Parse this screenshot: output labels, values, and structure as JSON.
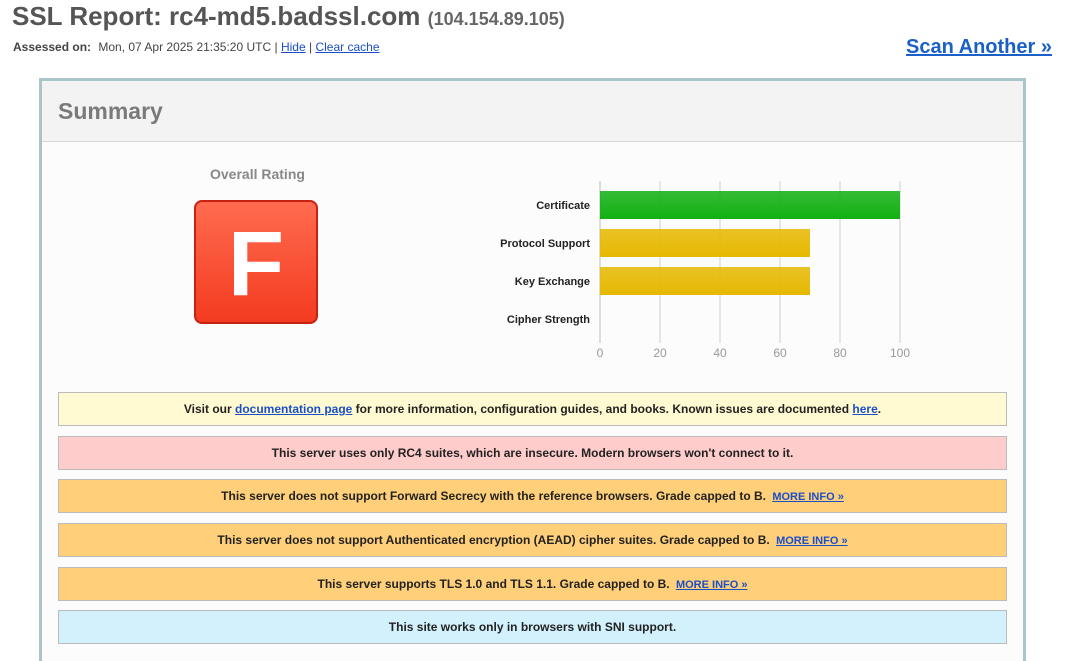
{
  "header": {
    "title_prefix": "SSL Report: ",
    "host": "rc4-md5.badssl.com",
    "ip": "(104.154.89.105)",
    "assessed_label": "Assessed on:",
    "assessed_value": "Mon, 07 Apr 2025 21:35:20 UTC",
    "separator": "|",
    "hide_link": "Hide",
    "clear_cache_link": "Clear cache",
    "scan_another": "Scan Another »"
  },
  "summary": {
    "title": "Summary",
    "overall_rating_label": "Overall Rating",
    "grade": "F",
    "grade_colors": {
      "top": "#ff6b4f",
      "bottom": "#f33b20",
      "border": "#c62212"
    }
  },
  "chart_data": {
    "type": "bar",
    "orientation": "horizontal",
    "categories": [
      "Certificate",
      "Protocol Support",
      "Key Exchange",
      "Cipher Strength"
    ],
    "values": [
      100,
      70,
      70,
      0
    ],
    "colors": [
      "#12b012",
      "#e6b800",
      "#e6b800",
      "#e6b800"
    ],
    "xlim": [
      0,
      100
    ],
    "xticks": [
      0,
      20,
      40,
      60,
      80,
      100
    ],
    "grid": true
  },
  "notices": [
    {
      "color": "yellow",
      "parts": [
        {
          "t": "text",
          "v": "Visit our "
        },
        {
          "t": "link",
          "v": "documentation page"
        },
        {
          "t": "text",
          "v": " for more information, configuration guides, and books. Known issues are documented "
        },
        {
          "t": "link",
          "v": "here"
        },
        {
          "t": "text",
          "v": "."
        }
      ]
    },
    {
      "color": "red",
      "parts": [
        {
          "t": "text",
          "v": "This server uses only RC4 suites, which are insecure. Modern browsers won't connect to it."
        }
      ]
    },
    {
      "color": "orange",
      "parts": [
        {
          "t": "text",
          "v": "This server does not support Forward Secrecy with the reference browsers. Grade capped to B. "
        },
        {
          "t": "more",
          "v": "MORE INFO »"
        }
      ]
    },
    {
      "color": "orange",
      "parts": [
        {
          "t": "text",
          "v": "This server does not support Authenticated encryption (AEAD) cipher suites. Grade capped to B. "
        },
        {
          "t": "more",
          "v": "MORE INFO »"
        }
      ]
    },
    {
      "color": "orange",
      "parts": [
        {
          "t": "text",
          "v": "This server supports TLS 1.0 and TLS 1.1. Grade capped to B. "
        },
        {
          "t": "more",
          "v": "MORE INFO »"
        }
      ]
    },
    {
      "color": "blue",
      "parts": [
        {
          "t": "text",
          "v": "This site works only in browsers with SNI support."
        }
      ]
    }
  ]
}
